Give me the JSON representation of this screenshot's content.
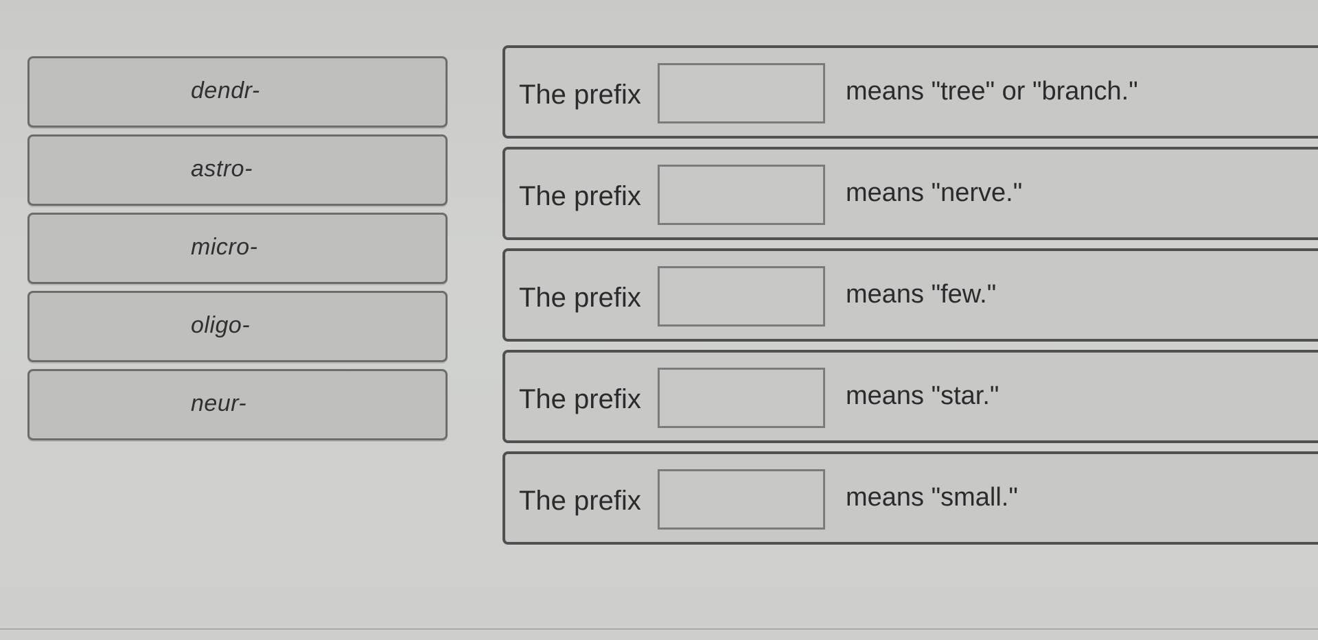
{
  "tiles": [
    {
      "label": "dendr-"
    },
    {
      "label": "astro-"
    },
    {
      "label": "micro-"
    },
    {
      "label": "oligo-"
    },
    {
      "label": "neur-"
    }
  ],
  "rows": [
    {
      "prefix": "The prefix",
      "meaning": "means \"tree\" or \"branch.\""
    },
    {
      "prefix": "The prefix",
      "meaning": "means \"nerve.\""
    },
    {
      "prefix": "The prefix",
      "meaning": "means \"few.\""
    },
    {
      "prefix": "The prefix",
      "meaning": "means \"star.\""
    },
    {
      "prefix": "The prefix",
      "meaning": "means \"small.\""
    }
  ]
}
